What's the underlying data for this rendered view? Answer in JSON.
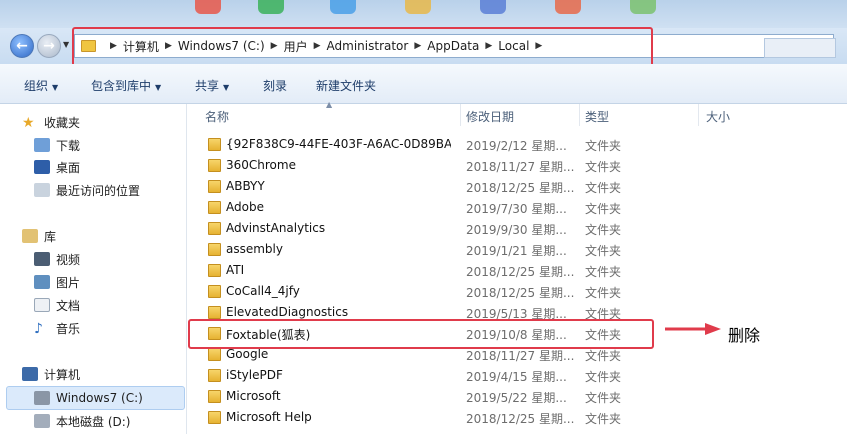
{
  "address": {
    "crumbs": [
      "计算机",
      "Windows7 (C:)",
      "用户",
      "Administrator",
      "AppData",
      "Local"
    ]
  },
  "toolbar": {
    "organize": "组织",
    "include_in_library": "包含到库中",
    "share": "共享",
    "burn": "刻录",
    "new_folder": "新建文件夹"
  },
  "nav": {
    "favorites": "收藏夹",
    "downloads": "下载",
    "desktop": "桌面",
    "recent": "最近访问的位置",
    "libraries": "库",
    "videos": "视频",
    "pictures": "图片",
    "documents": "文档",
    "music": "音乐",
    "computer": "计算机",
    "drive_c": "Windows7 (C:)",
    "drive_d": "本地磁盘 (D:)"
  },
  "columns": {
    "name": "名称",
    "date": "修改日期",
    "type": "类型",
    "size": "大小"
  },
  "files": [
    {
      "name": "{92F838C9-44FE-403F-A6AC-0D89BA...",
      "date": "2019/2/12 星期...",
      "type": "文件夹"
    },
    {
      "name": "360Chrome",
      "date": "2018/11/27 星期...",
      "type": "文件夹"
    },
    {
      "name": "ABBYY",
      "date": "2018/12/25 星期...",
      "type": "文件夹"
    },
    {
      "name": "Adobe",
      "date": "2019/7/30 星期...",
      "type": "文件夹"
    },
    {
      "name": "AdvinstAnalytics",
      "date": "2019/9/30 星期...",
      "type": "文件夹"
    },
    {
      "name": "assembly",
      "date": "2019/1/21 星期...",
      "type": "文件夹"
    },
    {
      "name": "ATI",
      "date": "2018/12/25 星期...",
      "type": "文件夹"
    },
    {
      "name": "CoCall4_4jfy",
      "date": "2018/12/25 星期...",
      "type": "文件夹"
    },
    {
      "name": "ElevatedDiagnostics",
      "date": "2019/5/13 星期...",
      "type": "文件夹"
    },
    {
      "name": "Foxtable(狐表)",
      "date": "2019/10/8 星期...",
      "type": "文件夹"
    },
    {
      "name": "Google",
      "date": "2018/11/27 星期...",
      "type": "文件夹"
    },
    {
      "name": "iStylePDF",
      "date": "2019/4/15 星期...",
      "type": "文件夹"
    },
    {
      "name": "Microsoft",
      "date": "2019/5/22 星期...",
      "type": "文件夹"
    },
    {
      "name": "Microsoft Help",
      "date": "2018/12/25 星期...",
      "type": "文件夹"
    }
  ],
  "annotation": {
    "label": "删除",
    "color": "#e03b4b"
  }
}
